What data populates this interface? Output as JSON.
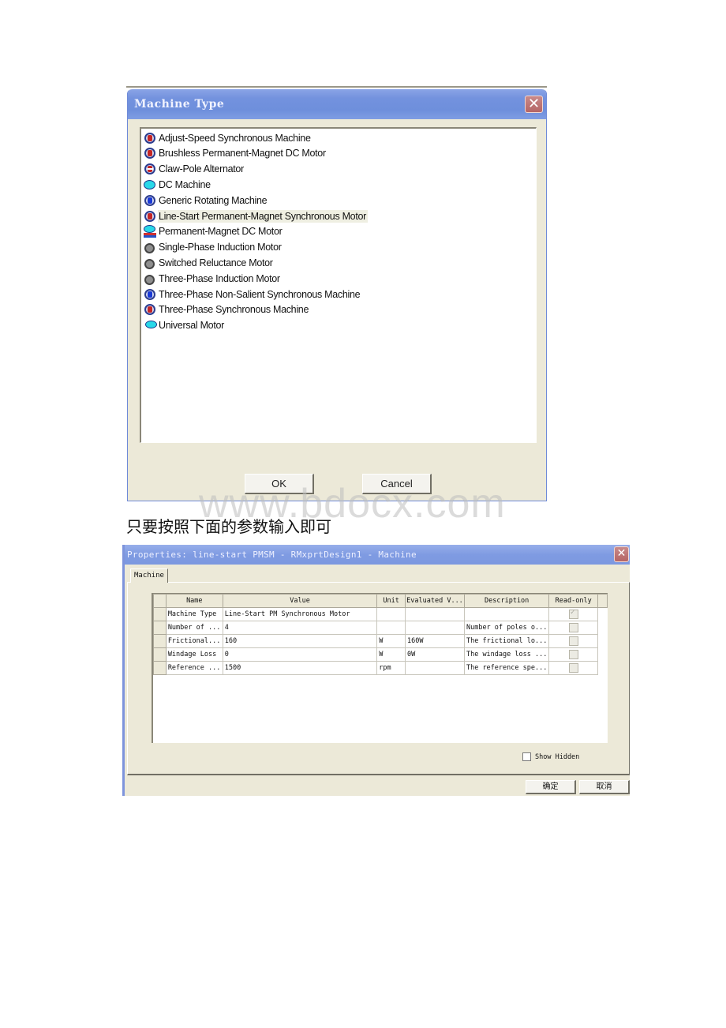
{
  "machine_type_dialog": {
    "title": "Machine Type",
    "close_icon": "close-icon",
    "items": [
      {
        "label": "Adjust-Speed  Synchronous Machine",
        "icon": "synchronous-machine-icon"
      },
      {
        "label": "Brushless Permanent-Magnet DC Motor",
        "icon": "brushless-dc-icon"
      },
      {
        "label": "Claw-Pole Alternator",
        "icon": "claw-pole-icon"
      },
      {
        "label": "DC Machine",
        "icon": "dc-machine-icon"
      },
      {
        "label": "Generic Rotating Machine",
        "icon": "generic-machine-icon"
      },
      {
        "label": "Line-Start Permanent-Magnet Synchronous Motor",
        "icon": "synchronous-machine-icon",
        "selected": true
      },
      {
        "label": "Permanent-Magnet DC Motor",
        "icon": "pm-dc-motor-icon"
      },
      {
        "label": "Single-Phase Induction Motor",
        "icon": "induction-motor-icon"
      },
      {
        "label": "Switched Reluctance Motor",
        "icon": "reluctance-motor-icon"
      },
      {
        "label": "Three-Phase Induction Motor",
        "icon": "induction-motor-icon"
      },
      {
        "label": "Three-Phase Non-Salient Synchronous Machine",
        "icon": "generic-machine-icon"
      },
      {
        "label": "Three-Phase Synchronous Machine",
        "icon": "synchronous-machine-icon"
      },
      {
        "label": "Universal Motor",
        "icon": "universal-motor-icon"
      }
    ],
    "ok_label": "OK",
    "cancel_label": "Cancel"
  },
  "watermark": "www.bdocx.com",
  "caption": "只要按照下面的参数输入即可",
  "properties_dialog": {
    "title": "Properties: line-start PMSM - RMxprtDesign1 - Machine",
    "tab": "Machine",
    "columns": [
      "Name",
      "Value",
      "Unit",
      "Evaluated V...",
      "Description",
      "Read-only"
    ],
    "rows": [
      {
        "name": "Machine Type",
        "value": "Line-Start PM Synchronous Motor",
        "unit": "",
        "evaluated": "",
        "description": "",
        "read_only": true
      },
      {
        "name": "Number of ...",
        "value": "4",
        "unit": "",
        "evaluated": "",
        "description": "Number of poles o...",
        "read_only": false
      },
      {
        "name": "Frictional...",
        "value": "160",
        "unit": "W",
        "evaluated": "160W",
        "description": "The frictional lo...",
        "read_only": false
      },
      {
        "name": "Windage Loss",
        "value": "0",
        "unit": "W",
        "evaluated": "0W",
        "description": "The windage loss ...",
        "read_only": false
      },
      {
        "name": "Reference ...",
        "value": "1500",
        "unit": "rpm",
        "evaluated": "",
        "description": "The reference spe...",
        "read_only": false
      }
    ],
    "show_hidden_label": "Show Hidden",
    "show_hidden_checked": false,
    "ok_label": "确定",
    "cancel_label": "取消"
  }
}
